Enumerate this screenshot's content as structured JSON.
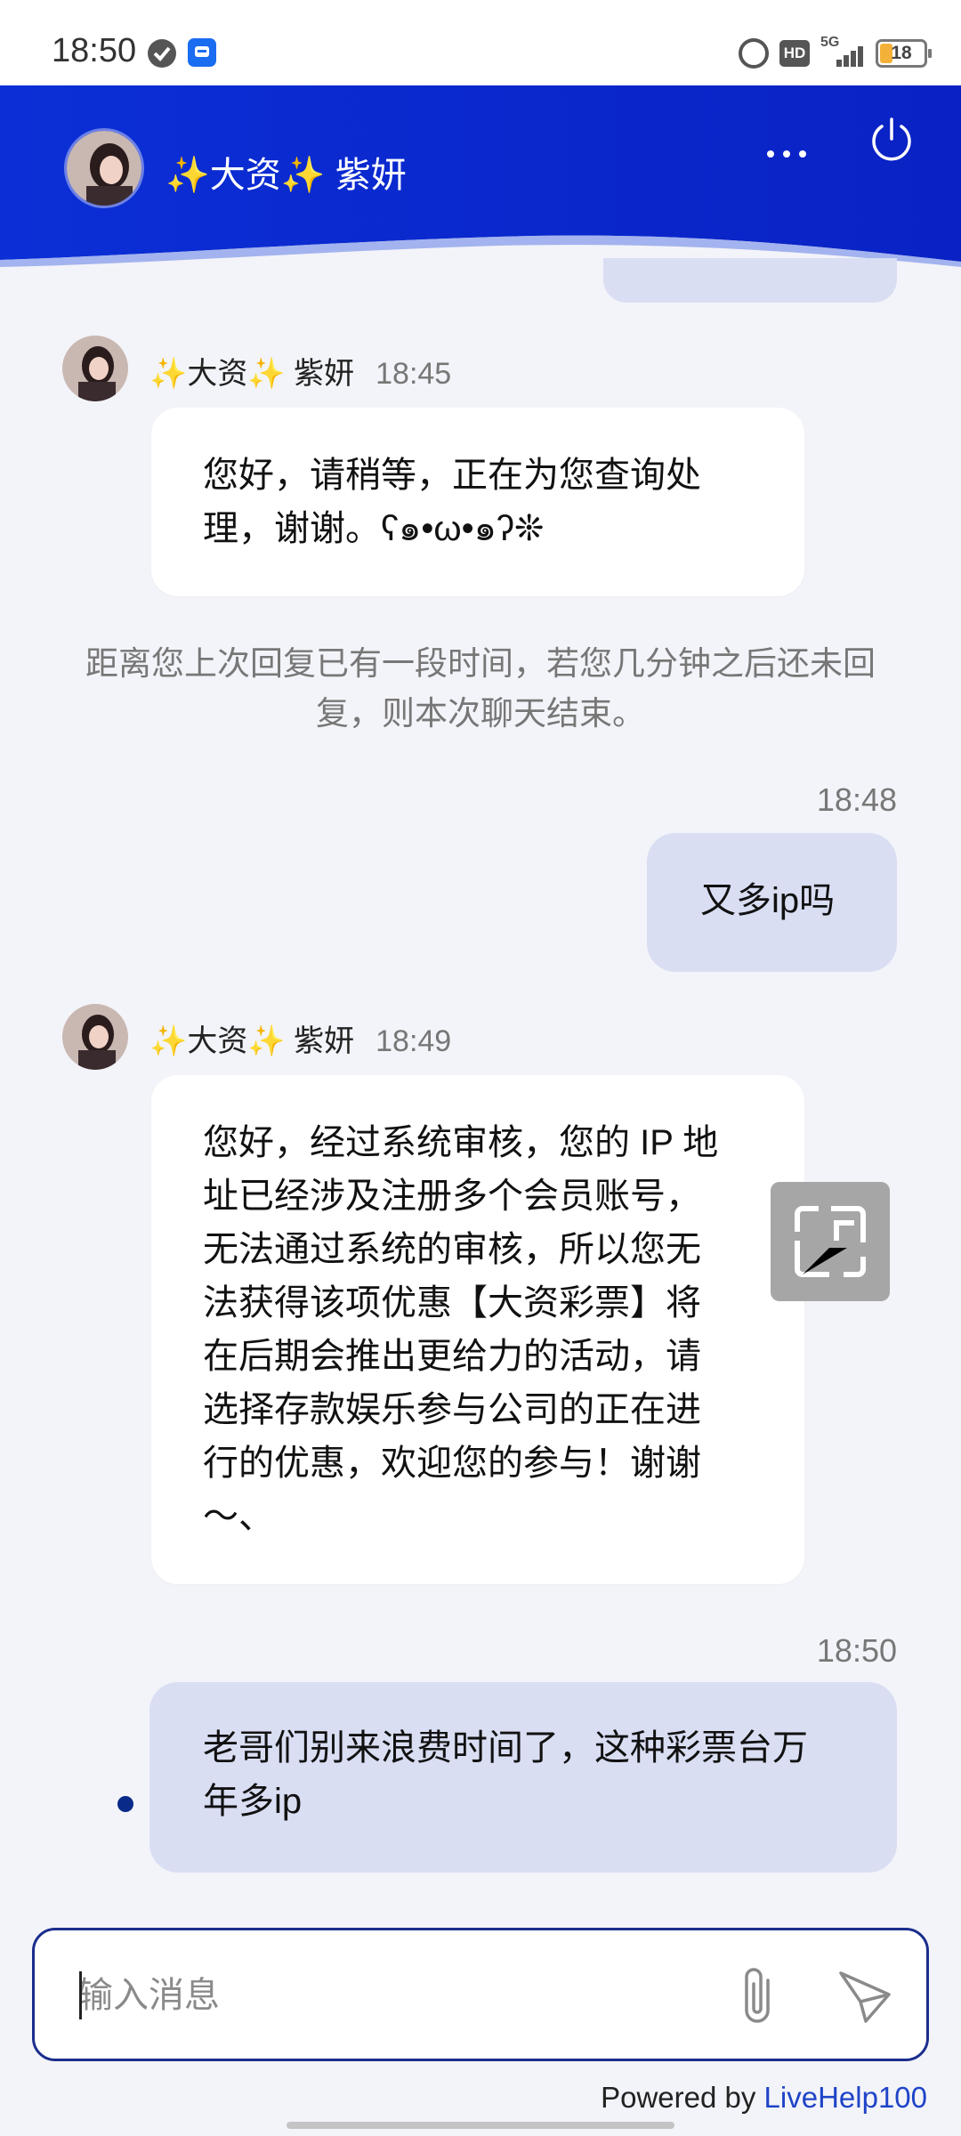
{
  "status_bar": {
    "time": "18:50",
    "network": "5G",
    "hd": "HD",
    "battery": "18"
  },
  "header": {
    "agent_name": "✨大资✨ 紫妍"
  },
  "messages": [
    {
      "sender": "✨大资✨ 紫妍",
      "time": "18:45",
      "line1": "您好，请稍等，正在为您查询处",
      "line2": "理，谢谢。ʕ๑•ω•๑ʔ❊"
    },
    {
      "system_line1": "距离您上次回复已有一段时间，若您几分钟之后还未回",
      "system_line2": "复，则本次聊天结束。"
    },
    {
      "time": "18:48",
      "text": "又多ip吗"
    },
    {
      "sender": "✨大资✨ 紫妍",
      "time": "18:49",
      "lines": [
        "您好，经过系统审核，您的 IP 地",
        "址已经涉及注册多个会员账号，",
        "无法通过系统的审核，所以您无",
        "法获得该项优惠【大资彩票】将",
        "在后期会推出更给力的活动，请",
        "选择存款娱乐参与公司的正在进",
        "行的优惠，欢迎您的参与！谢谢",
        "～、"
      ]
    },
    {
      "time": "18:50",
      "line1": "老哥们别来浪费时间了，这种彩票台万",
      "line2": "年多ip"
    }
  ],
  "input": {
    "placeholder": "输入消息"
  },
  "footer": {
    "powered_prefix": "Powered by ",
    "brand": "LiveHelp100"
  },
  "colors": {
    "header_blue": "#0a2ed8",
    "user_bubble": "#d9def3",
    "brand_link": "#1f44c7"
  }
}
